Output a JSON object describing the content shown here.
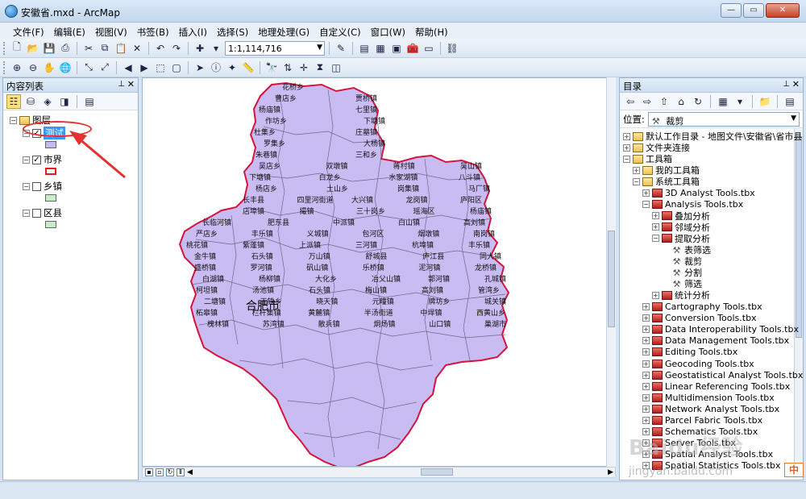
{
  "window": {
    "title": "安徽省.mxd - ArcMap",
    "buttons": {
      "minimize": "—",
      "maximize": "▭",
      "close": "✕"
    }
  },
  "menu": [
    "文件(F)",
    "编辑(E)",
    "视图(V)",
    "书签(B)",
    "插入(I)",
    "选择(S)",
    "地理处理(G)",
    "自定义(C)",
    "窗口(W)",
    "帮助(H)"
  ],
  "toolbar": {
    "scale": "1:1,114,716"
  },
  "toc": {
    "title": "内容列表",
    "root": "图层",
    "layers": [
      {
        "name": "测试",
        "checked": true,
        "selected": true,
        "swatch_color": "#c7b8f0",
        "swatch_border": "#666666"
      },
      {
        "name": "市界",
        "checked": true,
        "selected": false,
        "swatch_color": "#ffffff",
        "swatch_border": "#e02020"
      },
      {
        "name": "乡镇",
        "checked": false,
        "selected": false,
        "swatch_color": "#c9ecc9",
        "swatch_border": "#666666"
      },
      {
        "name": "区县",
        "checked": false,
        "selected": false,
        "swatch_color": "#c9ecc9",
        "swatch_border": "#666666"
      }
    ]
  },
  "map": {
    "fill_color": "#c8bcf2",
    "outline_color": "#d4143c",
    "city_label": "合肥市",
    "places": [
      "花桥乡",
      "曹店乡",
      "贾桥镇",
      "杨庙镇",
      "七里镇",
      "作坊乡",
      "下塘镇",
      "杜集乡",
      "庄墓镇",
      "罗集乡",
      "大杨镇",
      "朱巷镇",
      "三和乡",
      "吴店乡",
      "双墩镇",
      "蒋村镇",
      "吴山镇",
      "下塘镇",
      "白龙乡",
      "水家湖镇",
      "八斗镇",
      "杨店乡",
      "土山乡",
      "岗集镇",
      "马厂镇",
      "长丰县",
      "四里河街道",
      "大兴镇",
      "龙岗镇",
      "庐阳区",
      "店埠镇",
      "撮镇",
      "三十岗乡",
      "瑶海区",
      "杨庙镇",
      "长临河镇",
      "肥东县",
      "中派镇",
      "白山镇",
      "高刘镇",
      "严店乡",
      "丰乐镇",
      "义城镇",
      "包河区",
      "烟墩镇",
      "南岗镇",
      "桃花镇",
      "紫蓬镇",
      "上派镇",
      "三河镇",
      "杭埠镇",
      "丰乐镇",
      "金牛镇",
      "石头镇",
      "万山镇",
      "舒城县",
      "庐江县",
      "同大镇",
      "盛桥镇",
      "罗河镇",
      "矾山镇",
      "乐桥镇",
      "泥河镇",
      "龙桥镇",
      "白湖镇",
      "杨柳镇",
      "大化乡",
      "冶父山镇",
      "郭河镇",
      "孔城镇",
      "柯坦镇",
      "汤池镇",
      "石头镇",
      "梅山镇",
      "高刘镇",
      "管湾乡",
      "二塘镇",
      "王铁乡",
      "晓天镇",
      "元疃镇",
      "牌坊乡",
      "城关镇",
      "柘皋镇",
      "栏杆集镇",
      "黄麓镇",
      "半汤街道",
      "中垾镇",
      "西黄山乡",
      "槐林镇",
      "苏湾镇",
      "散兵镇",
      "烔炀镇",
      "山口镇",
      "巢湖市"
    ]
  },
  "catalog": {
    "title": "目录",
    "location_label": "位置:",
    "location_value": "裁剪",
    "items": [
      {
        "label": "默认工作目录 - 地图文件\\安徽省\\省市县",
        "icon": "folder",
        "indent": 0,
        "exp": "+"
      },
      {
        "label": "文件夹连接",
        "icon": "folder",
        "indent": 0,
        "exp": "+"
      },
      {
        "label": "工具箱",
        "icon": "folder",
        "indent": 0,
        "exp": "−"
      },
      {
        "label": "我的工具箱",
        "icon": "folder",
        "indent": 1,
        "exp": "+"
      },
      {
        "label": "系统工具箱",
        "icon": "folder",
        "indent": 1,
        "exp": "−"
      },
      {
        "label": "3D Analyst Tools.tbx",
        "icon": "toolbox",
        "indent": 2,
        "exp": "+"
      },
      {
        "label": "Analysis Tools.tbx",
        "icon": "toolbox",
        "indent": 2,
        "exp": "−"
      },
      {
        "label": "叠加分析",
        "icon": "toolbox",
        "indent": 3,
        "exp": "+"
      },
      {
        "label": "邻域分析",
        "icon": "toolbox",
        "indent": 3,
        "exp": "+"
      },
      {
        "label": "提取分析",
        "icon": "toolbox",
        "indent": 3,
        "exp": "−"
      },
      {
        "label": "表筛选",
        "icon": "tool",
        "indent": 4,
        "exp": ""
      },
      {
        "label": "裁剪",
        "icon": "tool",
        "indent": 4,
        "exp": ""
      },
      {
        "label": "分割",
        "icon": "tool",
        "indent": 4,
        "exp": ""
      },
      {
        "label": "筛选",
        "icon": "tool",
        "indent": 4,
        "exp": ""
      },
      {
        "label": "统计分析",
        "icon": "toolbox",
        "indent": 3,
        "exp": "+"
      },
      {
        "label": "Cartography Tools.tbx",
        "icon": "toolbox",
        "indent": 2,
        "exp": "+"
      },
      {
        "label": "Conversion Tools.tbx",
        "icon": "toolbox",
        "indent": 2,
        "exp": "+"
      },
      {
        "label": "Data Interoperability Tools.tbx",
        "icon": "toolbox",
        "indent": 2,
        "exp": "+"
      },
      {
        "label": "Data Management Tools.tbx",
        "icon": "toolbox",
        "indent": 2,
        "exp": "+"
      },
      {
        "label": "Editing Tools.tbx",
        "icon": "toolbox",
        "indent": 2,
        "exp": "+"
      },
      {
        "label": "Geocoding Tools.tbx",
        "icon": "toolbox",
        "indent": 2,
        "exp": "+"
      },
      {
        "label": "Geostatistical Analyst Tools.tbx",
        "icon": "toolbox",
        "indent": 2,
        "exp": "+"
      },
      {
        "label": "Linear Referencing Tools.tbx",
        "icon": "toolbox",
        "indent": 2,
        "exp": "+"
      },
      {
        "label": "Multidimension Tools.tbx",
        "icon": "toolbox",
        "indent": 2,
        "exp": "+"
      },
      {
        "label": "Network Analyst Tools.tbx",
        "icon": "toolbox",
        "indent": 2,
        "exp": "+"
      },
      {
        "label": "Parcel Fabric Tools.tbx",
        "icon": "toolbox",
        "indent": 2,
        "exp": "+"
      },
      {
        "label": "Schematics Tools.tbx",
        "icon": "toolbox",
        "indent": 2,
        "exp": "+"
      },
      {
        "label": "Server Tools.tbx",
        "icon": "toolbox",
        "indent": 2,
        "exp": "+"
      },
      {
        "label": "Spatial Analyst Tools.tbx",
        "icon": "toolbox",
        "indent": 2,
        "exp": "+"
      },
      {
        "label": "Spatial Statistics Tools.tbx",
        "icon": "toolbox",
        "indent": 2,
        "exp": "+"
      }
    ]
  },
  "watermark": {
    "brand": "Baidu经验",
    "url": "jingyan.baidu.com"
  },
  "ime": "中"
}
